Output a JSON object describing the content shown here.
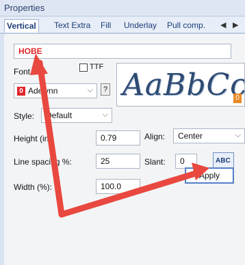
{
  "window": {
    "title": "Properties"
  },
  "tabs": [
    {
      "label": "Vertical",
      "active": true
    },
    {
      "label": "Text Extra"
    },
    {
      "label": "Fill"
    },
    {
      "label": "Underlay"
    },
    {
      "label": "Pull comp."
    }
  ],
  "tab_nav": {
    "prev": "◀",
    "next": "▶"
  },
  "text_input": {
    "value": "HOBE"
  },
  "font": {
    "label": "Font",
    "ttf_label": "TTF",
    "ttf_checked": false,
    "marker": "0",
    "selected": "Adelynn",
    "help_label": "?"
  },
  "preview": {
    "sample_text": "AaBbCc",
    "badge": "0"
  },
  "style": {
    "label": "Style:",
    "selected": "Default"
  },
  "height": {
    "label": "Height (in):",
    "value": "0.79"
  },
  "align": {
    "label": "Align:",
    "selected": "Center"
  },
  "line_spacing": {
    "label": "Line spacing %:",
    "value": "25"
  },
  "slant": {
    "label": "Slant:",
    "value": "0"
  },
  "width": {
    "label": "Width (%):",
    "value": "100.0"
  },
  "spell_check_button": {
    "label": "ABC"
  },
  "apply_button": {
    "label": "Apply"
  },
  "colors": {
    "accent_red": "#e0262b",
    "arrow": "#e8483f",
    "tab_text": "#1a3b78"
  }
}
